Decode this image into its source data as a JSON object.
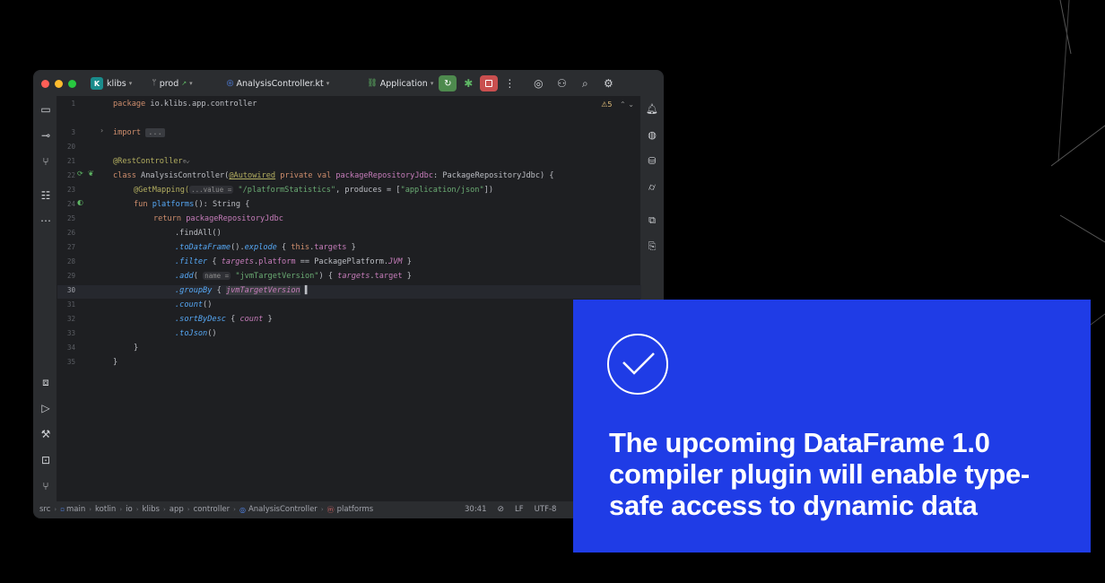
{
  "titlebar": {
    "project": "klibs",
    "project_badge": "K",
    "branch": "prod",
    "file_tab": "AnalysisController.kt",
    "run_config": "Application"
  },
  "editor": {
    "warnings": "5",
    "lines": [
      {
        "n": "1",
        "text": "package io.klibs.app.controller"
      },
      {
        "n": "3",
        "text": "import ..."
      },
      {
        "n": "20",
        "text": ""
      },
      {
        "n": "21",
        "text": "@RestController"
      },
      {
        "n": "22",
        "text": "class AnalysisController(@Autowired private val packageRepositoryJdbc: PackageRepositoryJdbc) {"
      },
      {
        "n": "23",
        "text": "@GetMapping(value = \"/platformStatistics\", produces = [\"application/json\"])"
      },
      {
        "n": "24",
        "text": "fun platforms(): String {"
      },
      {
        "n": "25",
        "text": "return packageRepositoryJdbc"
      },
      {
        "n": "26",
        "text": ".findAll()"
      },
      {
        "n": "27",
        "text": ".toDataFrame().explode { this.targets }"
      },
      {
        "n": "28",
        "text": ".filter { targets.platform == PackagePlatform.JVM }"
      },
      {
        "n": "29",
        "text": ".add( name = \"jvmTargetVersion\") { targets.target }"
      },
      {
        "n": "30",
        "text": ".groupBy { jvmTargetVersion }"
      },
      {
        "n": "31",
        "text": ".count()"
      },
      {
        "n": "32",
        "text": ".sortByDesc { count }"
      },
      {
        "n": "33",
        "text": ".toJson()"
      },
      {
        "n": "34",
        "text": "}"
      },
      {
        "n": "35",
        "text": "}"
      }
    ],
    "hints": {
      "value_hint": "...value =",
      "name_hint": "name ="
    }
  },
  "statusbar": {
    "breadcrumbs": [
      "src",
      "main",
      "kotlin",
      "io",
      "klibs",
      "app",
      "controller",
      "AnalysisController",
      "platforms"
    ],
    "position": "30:41",
    "line_ending": "LF",
    "encoding": "UTF-8"
  },
  "card": {
    "text": "The upcoming DataFrame 1.0 compiler plugin will enable type-safe access to dynamic data",
    "color": "#1f3ce6"
  }
}
